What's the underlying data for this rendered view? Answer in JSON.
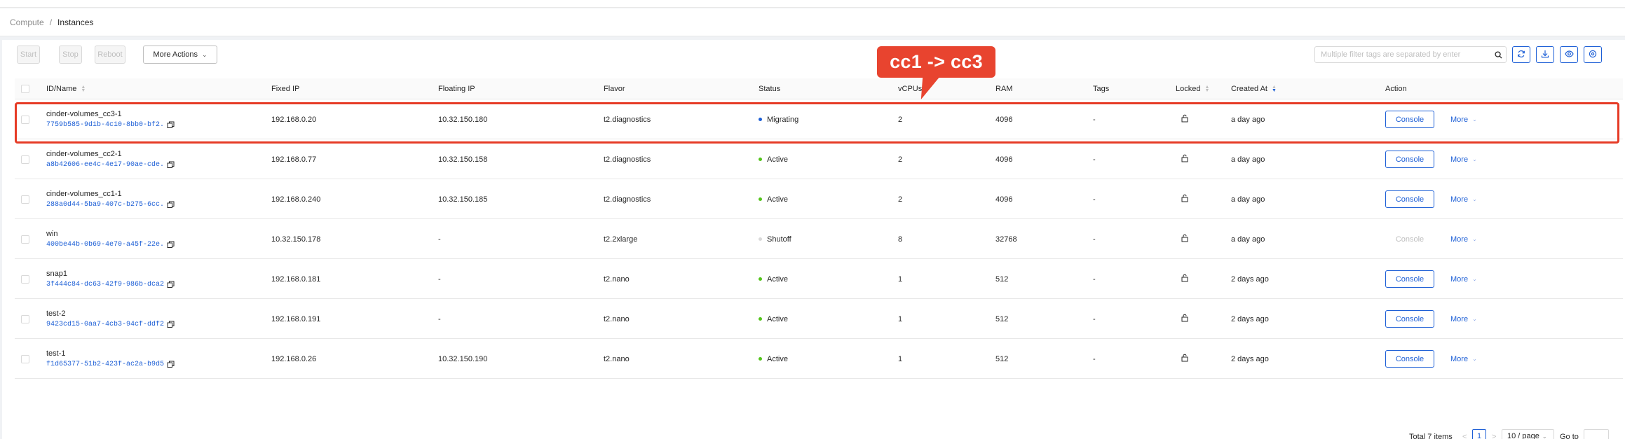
{
  "breadcrumb": {
    "parent": "Compute",
    "separator": "/",
    "current": "Instances"
  },
  "toolbar": {
    "start_label": "Start",
    "stop_label": "Stop",
    "reboot_label": "Reboot",
    "more_actions_label": "More Actions",
    "search_placeholder": "Multiple filter tags are separated by enter",
    "icons": [
      "search-icon",
      "refresh-icon",
      "download-icon",
      "eye-icon",
      "settings-icon"
    ]
  },
  "table": {
    "columns": {
      "id_name": "ID/Name",
      "fixed_ip": "Fixed IP",
      "floating_ip": "Floating IP",
      "flavor": "Flavor",
      "status": "Status",
      "vcpus": "vCPUs",
      "ram": "RAM",
      "tags": "Tags",
      "locked": "Locked",
      "created_at": "Created At",
      "action": "Action"
    },
    "rows": [
      {
        "name": "cinder-volumes_cc3-1",
        "id": "7759b585-9d1b-4c10-8bb0-bf2...",
        "fixed_ip": "192.168.0.20",
        "floating_ip": "10.32.150.180",
        "flavor": "t2.diagnostics",
        "status": "Migrating",
        "status_color": "#1d5fd6",
        "vcpus": "2",
        "ram": "4096",
        "tags": "-",
        "created": "a day ago",
        "console": "Console",
        "more": "More"
      },
      {
        "name": "cinder-volumes_cc2-1",
        "id": "a8b42606-ee4c-4e17-90ae-cde...",
        "fixed_ip": "192.168.0.77",
        "floating_ip": "10.32.150.158",
        "flavor": "t2.diagnostics",
        "status": "Active",
        "status_color": "#52c41a",
        "vcpus": "2",
        "ram": "4096",
        "tags": "-",
        "created": "a day ago",
        "console": "Console",
        "more": "More"
      },
      {
        "name": "cinder-volumes_cc1-1",
        "id": "288a0d44-5ba9-407c-b275-6cc...",
        "fixed_ip": "192.168.0.240",
        "floating_ip": "10.32.150.185",
        "flavor": "t2.diagnostics",
        "status": "Active",
        "status_color": "#52c41a",
        "vcpus": "2",
        "ram": "4096",
        "tags": "-",
        "created": "a day ago",
        "console": "Console",
        "more": "More"
      },
      {
        "name": "win",
        "id": "400be44b-0b69-4e70-a45f-22e...",
        "fixed_ip": "10.32.150.178",
        "floating_ip": "-",
        "flavor": "t2.2xlarge",
        "status": "Shutoff",
        "status_color": "#d9d9d9",
        "vcpus": "8",
        "ram": "32768",
        "tags": "-",
        "created": "a day ago",
        "console": "Console",
        "more": "More"
      },
      {
        "name": "snap1",
        "id": "3f444c84-dc63-42f9-986b-dca2...",
        "fixed_ip": "192.168.0.181",
        "floating_ip": "-",
        "flavor": "t2.nano",
        "status": "Active",
        "status_color": "#52c41a",
        "vcpus": "1",
        "ram": "512",
        "tags": "-",
        "created": "2 days ago",
        "console": "Console",
        "more": "More"
      },
      {
        "name": "test-2",
        "id": "9423cd15-0aa7-4cb3-94cf-ddf2...",
        "fixed_ip": "192.168.0.191",
        "floating_ip": "-",
        "flavor": "t2.nano",
        "status": "Active",
        "status_color": "#52c41a",
        "vcpus": "1",
        "ram": "512",
        "tags": "-",
        "created": "2 days ago",
        "console": "Console",
        "more": "More"
      },
      {
        "name": "test-1",
        "id": "f1d65377-51b2-423f-ac2a-b9d5...",
        "fixed_ip": "192.168.0.26",
        "floating_ip": "10.32.150.190",
        "flavor": "t2.nano",
        "status": "Active",
        "status_color": "#52c41a",
        "vcpus": "1",
        "ram": "512",
        "tags": "-",
        "created": "2 days ago",
        "console": "Console",
        "more": "More"
      }
    ]
  },
  "annotation": {
    "text": "cc1 -> cc3",
    "color": "#e8442f"
  },
  "pagination": {
    "total": "Total 7 items",
    "prev": "<",
    "current_page": "1",
    "next": ">",
    "page_size": "10 / page",
    "goto_label": "Go to"
  },
  "colors": {
    "primary": "#1d5fd6",
    "active": "#52c41a",
    "shutoff": "#d9d9d9",
    "annotation": "#e63b26"
  }
}
